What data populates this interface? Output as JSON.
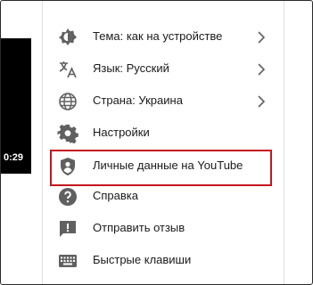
{
  "video": {
    "time": "0:29"
  },
  "menu": {
    "items": [
      {
        "label": "Тема: как на устройстве",
        "icon": "theme-icon",
        "has_submenu": true
      },
      {
        "label": "Язык: Русский",
        "icon": "translate-icon",
        "has_submenu": true
      },
      {
        "label": "Страна: Украина",
        "icon": "globe-icon",
        "has_submenu": true
      },
      {
        "label": "Настройки",
        "icon": "gear-icon",
        "has_submenu": false
      },
      {
        "label": "Личные данные на YouTube",
        "icon": "shield-person-icon",
        "has_submenu": false,
        "highlighted": true
      },
      {
        "label": "Справка",
        "icon": "help-icon",
        "has_submenu": false
      },
      {
        "label": "Отправить отзыв",
        "icon": "feedback-icon",
        "has_submenu": false
      },
      {
        "label": "Быстрые клавиши",
        "icon": "keyboard-icon",
        "has_submenu": false
      }
    ]
  },
  "colors": {
    "icon": "#606060",
    "text": "#1a1a1a",
    "highlight_border": "#c4161c",
    "video_bg": "#000000"
  }
}
